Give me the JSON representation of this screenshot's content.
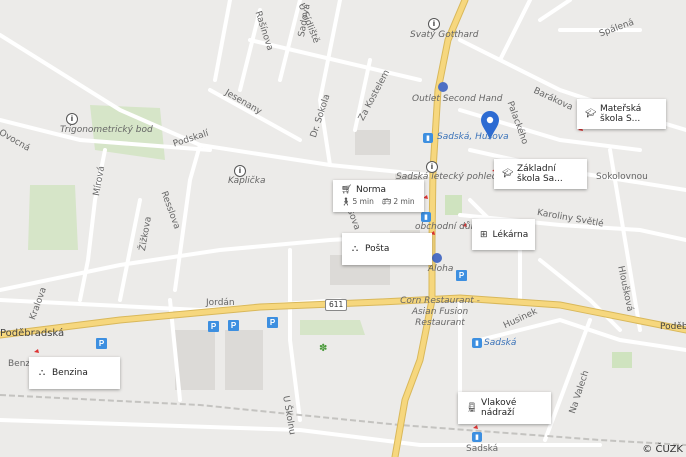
{
  "map": {
    "copyright": "© ČUZK",
    "route_number": "611",
    "place_labels": [
      {
        "text": "Svatý Gotthard"
      },
      {
        "text": "Outlet Second Hand"
      },
      {
        "text": "Trigonometrický bod"
      },
      {
        "text": "Kaplička"
      },
      {
        "text": "Sadská letecký pohled"
      },
      {
        "text": "obchodní dům"
      },
      {
        "text": "Aloha"
      },
      {
        "text": "Corn Restaurant - Asian Fusion Restaurant"
      },
      {
        "text": "Sadská, Husova"
      },
      {
        "text": "Sadská"
      },
      {
        "text": "Sadská"
      }
    ],
    "street_labels": [
      {
        "text": "Ovocná"
      },
      {
        "text": "U Sídliště"
      },
      {
        "text": "Sadová"
      },
      {
        "text": "Rašínova"
      },
      {
        "text": "Jesenany"
      },
      {
        "text": "Dr. Sokola"
      },
      {
        "text": "Za Kostelem"
      },
      {
        "text": "Podskalí"
      },
      {
        "text": "Mírová"
      },
      {
        "text": "Žižkova"
      },
      {
        "text": "Resslova"
      },
      {
        "text": "Jordán"
      },
      {
        "text": "Kralova"
      },
      {
        "text": "Poděbradská"
      },
      {
        "text": "Benzín"
      },
      {
        "text": "Barákova"
      },
      {
        "text": "Spálená"
      },
      {
        "text": "Palackého"
      },
      {
        "text": "Sokolovnou"
      },
      {
        "text": "Karoliny Světlé"
      },
      {
        "text": "Hloušková"
      },
      {
        "text": "Husinek"
      },
      {
        "text": "Na Valech"
      },
      {
        "text": "U Školnu"
      },
      {
        "text": "Poděbradská"
      },
      {
        "text": "Tyršova"
      }
    ],
    "cards": [
      {
        "label": "Mateřská škola S...",
        "icon": "graduation-cap-icon"
      },
      {
        "label": "Základní škola Sa...",
        "icon": "graduation-cap-icon"
      },
      {
        "label": "Norma",
        "icon": "shopping-cart-icon",
        "walk": "5 min",
        "transit": "2 min"
      },
      {
        "label": "Lékárna",
        "icon": "pharmacy-cross-icon"
      },
      {
        "label": "Pošta",
        "icon": "network-icon"
      },
      {
        "label": "Benzina",
        "icon": "network-icon"
      },
      {
        "label": "Vlakové nádraží",
        "icon": "train-icon"
      }
    ],
    "parking_symbol": "P",
    "colors": {
      "background": "#ecebe9",
      "main_road": "#f4cd6e",
      "road": "#ffffff",
      "green": "#cfe3bf",
      "pin": "#2d6bd2",
      "parking": "#3d8fe0"
    }
  }
}
